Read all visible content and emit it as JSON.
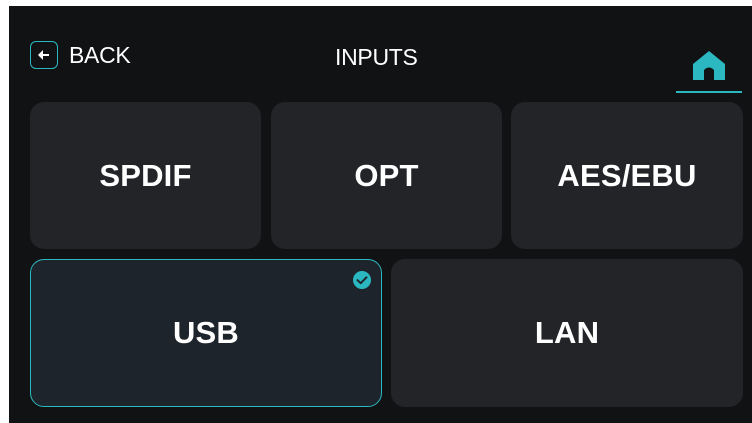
{
  "header": {
    "back_label": "BACK",
    "title": "INPUTS"
  },
  "inputs": [
    {
      "label": "SPDIF",
      "selected": false
    },
    {
      "label": "OPT",
      "selected": false
    },
    {
      "label": "AES/EBU",
      "selected": false
    },
    {
      "label": "USB",
      "selected": true
    },
    {
      "label": "LAN",
      "selected": false
    }
  ],
  "colors": {
    "accent": "#2bb8c0",
    "background": "#111214",
    "tile": "#222427",
    "tile_selected": "#1d242b",
    "text": "#ffffff"
  },
  "icons": {
    "back": "arrow-left-icon",
    "home": "home-icon",
    "selected": "check-circle-icon"
  }
}
